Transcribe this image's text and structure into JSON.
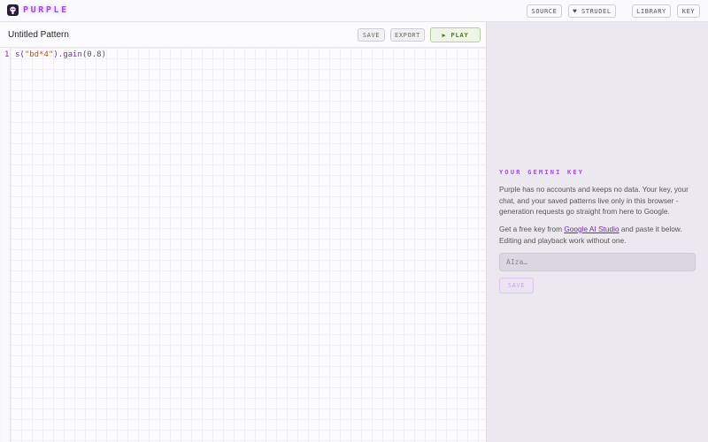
{
  "app": {
    "name": "PURPLE",
    "logo_icon": "flower-bulb-icon",
    "accent_color": "#a24de0"
  },
  "nav": {
    "source_label": "SOURCE",
    "strudel_label": "♥ STRUDEL",
    "library_label": "LIBRARY",
    "key_label": "KEY"
  },
  "editor": {
    "title": "Untitled Pattern",
    "save_label": "SAVE",
    "export_label": "EXPORT",
    "play_label": "▶ PLAY",
    "lines": [
      {
        "number": "1",
        "tokens": [
          {
            "text": "s(",
            "kind": "fn"
          },
          {
            "text": "\"bd*4\"",
            "kind": "str"
          },
          {
            "text": ").gain(",
            "kind": "fn"
          },
          {
            "text": "0.8",
            "kind": "num"
          },
          {
            "text": ")",
            "kind": "punc"
          }
        ]
      }
    ]
  },
  "key_panel": {
    "title": "YOUR GEMINI KEY",
    "para1": "Purple has no accounts and keeps no data. Your key, your chat, and your saved patterns live only in this browser - generation requests go straight from here to Google.",
    "para2_before": "Get a free key from ",
    "para2_link": "Google AI Studio",
    "para2_after": " and paste it below. Editing and playback work without one.",
    "input_placeholder": "AIza…",
    "input_value": "",
    "save_label": "SAVE"
  }
}
